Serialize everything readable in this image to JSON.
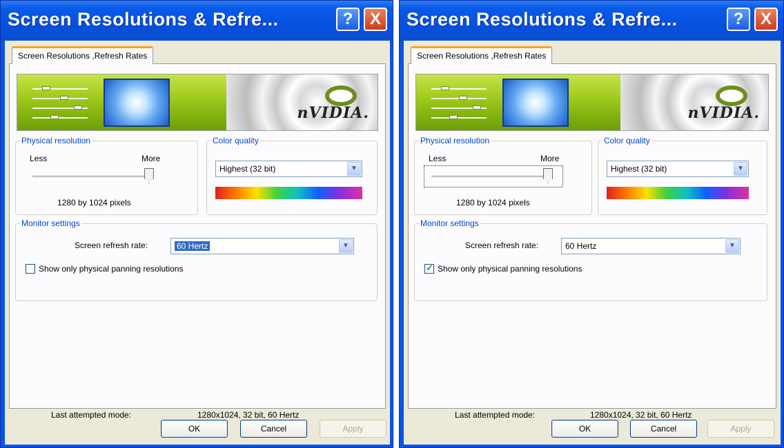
{
  "colors": {
    "titlebar": "#0a54e6",
    "client_bg": "#ece9d8",
    "group_legend": "#0046d5",
    "tab_accent": "#f6a21a"
  },
  "icons": [
    "help-icon",
    "close-icon",
    "dropdown-arrow-icon",
    "nvidia-logo"
  ],
  "dialogs": [
    {
      "title": "Screen Resolutions & Refre...",
      "help_button": "?",
      "close_button": "X",
      "tab": "Screen Resolutions ,Refresh Rates",
      "banner_brand": "nVIDIA.",
      "physical_resolution": {
        "legend": "Physical resolution",
        "less": "Less",
        "more": "More",
        "value": "1280 by 1024 pixels",
        "slider_level_percent": 100,
        "focused": false
      },
      "color_quality": {
        "legend": "Color quality",
        "selected": "Highest (32 bit)"
      },
      "monitor_settings": {
        "legend": "Monitor settings",
        "refresh_label": "Screen refresh rate:",
        "refresh_selected": "60 Hertz",
        "refresh_highlighted": true,
        "checkbox_label": "Show only physical panning resolutions",
        "checkbox_checked": false
      },
      "last_mode": {
        "label": "Last attempted mode:",
        "value": "1280x1024, 32 bit, 60 Hertz"
      },
      "buttons": {
        "ok": "OK",
        "cancel": "Cancel",
        "apply": "Apply"
      }
    },
    {
      "title": "Screen Resolutions & Refre...",
      "help_button": "?",
      "close_button": "X",
      "tab": "Screen Resolutions ,Refresh Rates",
      "banner_brand": "nVIDIA.",
      "physical_resolution": {
        "legend": "Physical resolution",
        "less": "Less",
        "more": "More",
        "value": "1280 by 1024 pixels",
        "slider_level_percent": 100,
        "focused": true
      },
      "color_quality": {
        "legend": "Color quality",
        "selected": "Highest (32 bit)"
      },
      "monitor_settings": {
        "legend": "Monitor settings",
        "refresh_label": "Screen refresh rate:",
        "refresh_selected": "60 Hertz",
        "refresh_highlighted": false,
        "checkbox_label": "Show only physical panning resolutions",
        "checkbox_checked": true
      },
      "last_mode": {
        "label": "Last attempted mode:",
        "value": "1280x1024, 32 bit, 60 Hertz"
      },
      "buttons": {
        "ok": "OK",
        "cancel": "Cancel",
        "apply": "Apply"
      }
    }
  ]
}
